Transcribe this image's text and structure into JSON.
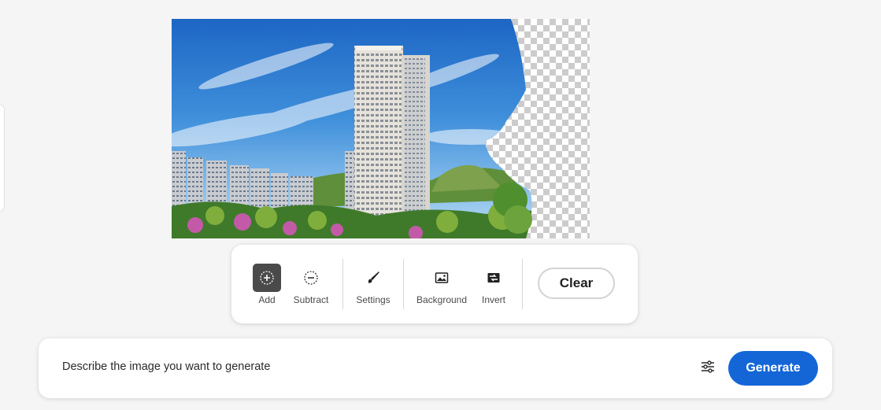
{
  "tools": [
    {
      "label": "Add",
      "icon": "add-circle-icon"
    },
    {
      "label": "Subtract",
      "icon": "subtract-circle-icon"
    },
    {
      "label": "Settings",
      "icon": "brush-icon"
    },
    {
      "label": "Background",
      "icon": "image-icon"
    },
    {
      "label": "Invert",
      "icon": "invert-icon"
    }
  ],
  "toolbar": {
    "clear_label": "Clear"
  },
  "prompt": {
    "placeholder": "Describe the image you want to generate",
    "options_icon": "sliders-icon",
    "generate_label": "Generate"
  },
  "canvas": {
    "image_icon": "building-photo",
    "transparent_icon": "checkerboard"
  },
  "colors": {
    "accent": "#1466d7",
    "active_tool_bg": "#4a4a4a",
    "page_bg": "#f5f5f5"
  }
}
